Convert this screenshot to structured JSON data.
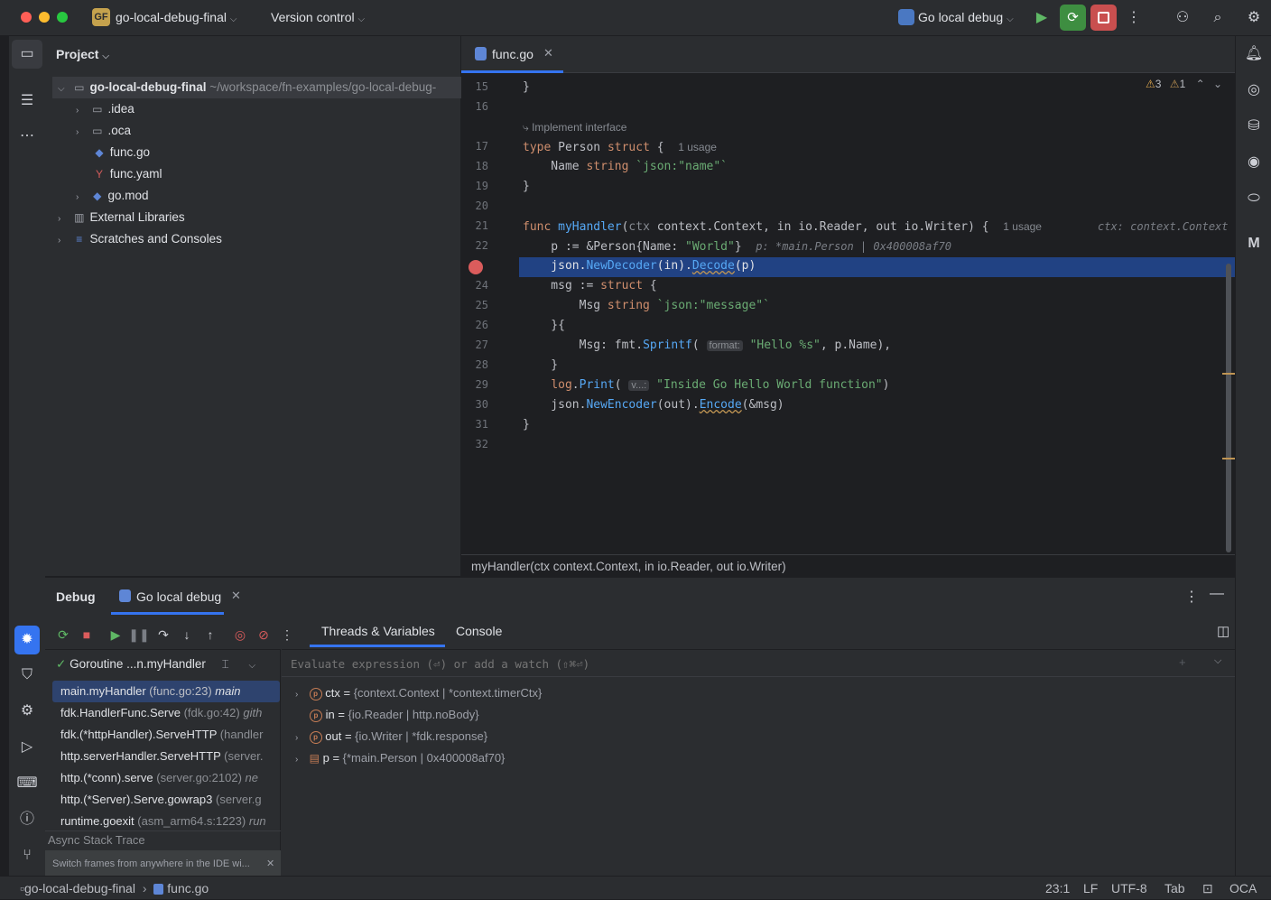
{
  "titlebar": {
    "project_badge": "GF",
    "project_name": "go-local-debug-final",
    "vcs_label": "Version control",
    "run_config": "Go local debug"
  },
  "project_panel": {
    "title": "Project",
    "root_name": "go-local-debug-final",
    "root_path": "~/workspace/fn-examples/go-local-debug-",
    "items": [
      {
        "label": ".idea"
      },
      {
        "label": ".oca"
      },
      {
        "label": "func.go"
      },
      {
        "label": "func.yaml"
      },
      {
        "label": "go.mod"
      },
      {
        "label": "External Libraries"
      },
      {
        "label": "Scratches and Consoles"
      }
    ]
  },
  "editor": {
    "tab_label": "func.go",
    "inspection_warnings": "3",
    "inspection_weak": "1",
    "implement_hint": "Implement interface",
    "usage_hint": "1 usage",
    "line_numbers": [
      "15",
      "16",
      "17",
      "18",
      "19",
      "20",
      "21",
      "22",
      "23",
      "24",
      "25",
      "26",
      "27",
      "28",
      "29",
      "30",
      "31",
      "32"
    ],
    "ctx_inline_hint": "ctx: context.Context",
    "p_inline_hint": "p: *main.Person | 0x400008af70",
    "format_hint": "format:",
    "v_hint": "v...:",
    "breadcrumb": "myHandler(ctx context.Context, in io.Reader, out io.Writer)"
  },
  "debug": {
    "title": "Debug",
    "session_tab": "Go local debug",
    "tab_threads": "Threads & Variables",
    "tab_console": "Console",
    "goroutine_label": "Goroutine ...n.myHandler",
    "eval_placeholder": "Evaluate expression (⏎) or add a watch (⇧⌘⏎)",
    "frames": [
      {
        "fn": "main.myHandler",
        "loc": "(func.go:23)",
        "thr": "main"
      },
      {
        "fn": "fdk.HandlerFunc.Serve",
        "loc": "(fdk.go:42)",
        "thr": "gith"
      },
      {
        "fn": "fdk.(*httpHandler).ServeHTTP",
        "loc": "(handler",
        "thr": ""
      },
      {
        "fn": "http.serverHandler.ServeHTTP",
        "loc": "(server.",
        "thr": ""
      },
      {
        "fn": "http.(*conn).serve",
        "loc": "(server.go:2102)",
        "thr": "ne"
      },
      {
        "fn": "http.(*Server).Serve.gowrap3",
        "loc": "(server.g",
        "thr": ""
      },
      {
        "fn": "runtime.goexit",
        "loc": "(asm_arm64.s:1223)",
        "thr": "run"
      }
    ],
    "async_label": "Async Stack Trace",
    "switch_hint": "Switch frames from anywhere in the IDE wi...",
    "variables": [
      {
        "name": "ctx",
        "value": "{context.Context | *context.timerCtx}"
      },
      {
        "name": "in",
        "value": "{io.Reader | http.noBody}"
      },
      {
        "name": "out",
        "value": "{io.Writer | *fdk.response}"
      },
      {
        "name": "p",
        "value": "{*main.Person | 0x400008af70}"
      }
    ]
  },
  "statusbar": {
    "project": "go-local-debug-final",
    "file": "func.go",
    "position": "23:1",
    "line_sep": "LF",
    "encoding": "UTF-8",
    "indent": "Tab",
    "plugin": "OCA"
  },
  "colors": {
    "accent": "#3574f0",
    "highlight_line": "#214283",
    "run_green": "#3e8e41",
    "stop_red": "#c94f4f"
  }
}
